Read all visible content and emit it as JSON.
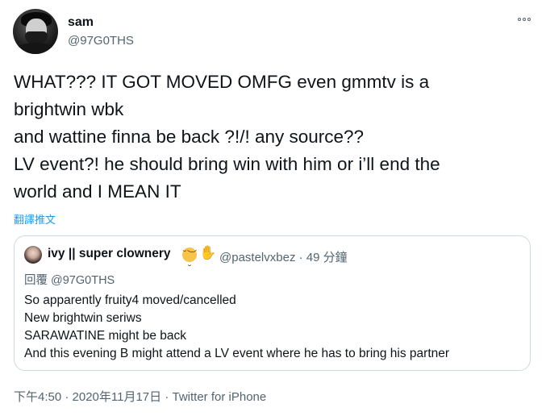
{
  "author": {
    "display_name": "sam",
    "handle": "@97G0THS"
  },
  "tweet": {
    "lines": [
      "WHAT??? IT GOT MOVED OMFG even gmmtv is a",
      "brightwin wbk",
      "and wattine finna be back ?!/! any source??",
      "LV event?! he should bring win with him or i’ll end the",
      "world and I MEAN IT"
    ],
    "translate_label": "翻譯推文"
  },
  "quoted_tweet": {
    "display_name": "ivy || super clownery",
    "emoji": [
      "pensive-face",
      "raised-hand"
    ],
    "handle": "@pastelvxbez",
    "separator": "·",
    "time": "49 分鐘",
    "reply_to": "回覆 @97G0THS",
    "lines": [
      "So apparently fruity4 moved/cancelled",
      "New brightwin seriws",
      "SARAWATINE might be back",
      "And this evening B might attend a LV event where he has to bring his partner"
    ]
  },
  "footer": {
    "timestamp": "下午4:50 · 2020年11月17日",
    "separator": "·",
    "source": "Twitter for iPhone"
  },
  "colors": {
    "text": "#0f1419",
    "secondary": "#536471",
    "link": "#1d9bf0",
    "border": "#cfd9de"
  }
}
